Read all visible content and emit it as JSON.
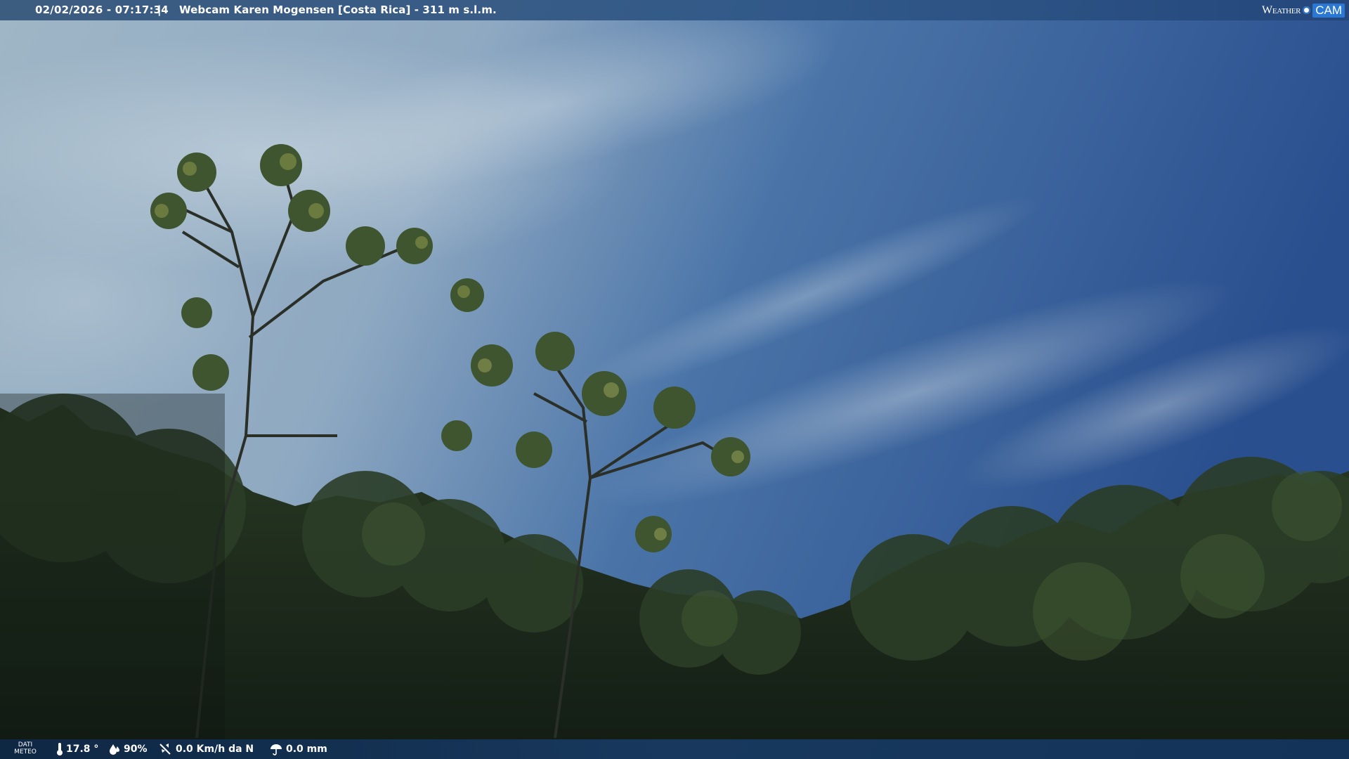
{
  "header": {
    "timestamp": "02/02/2026 - 07:17:34",
    "separator": "|",
    "title": "Webcam Karen Mogensen [Costa Rica] - 311 m s.l.m.",
    "logo": {
      "part1": "Weather",
      "part2": "CAM"
    }
  },
  "footer": {
    "label_line1": "DATI",
    "label_line2": "METEO",
    "temperature": "17.8 °",
    "humidity": "90%",
    "wind": "0.0 Km/h da N",
    "rain": "0.0 mm"
  },
  "icons": [
    "thermometer-icon",
    "humidity-icon",
    "wind-icon",
    "rain-icon"
  ],
  "colors": {
    "sky_top": "#2c5390",
    "sky_light": "#a7bacb",
    "foliage": "#1d2a1c",
    "bar": "#1c3b64"
  }
}
